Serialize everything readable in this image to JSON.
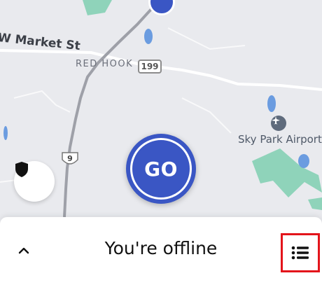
{
  "map": {
    "street_label": "W Market St",
    "town_label": "RED HOOK",
    "route_199": "199",
    "route_9": "9",
    "airport_label": "Sky Park Airport",
    "icons": [
      "navigation-marker-icon",
      "airport-icon"
    ]
  },
  "go_button": {
    "label": "GO"
  },
  "safety": {
    "icon": "shield-icon"
  },
  "bottom_sheet": {
    "title": "You're offline",
    "expand_icon": "chevron-up-icon",
    "menu_icon": "list-icon"
  },
  "colors": {
    "go_blue": "#3a56c4",
    "map_bg": "#e9eaee",
    "park_green": "#8fd3ba",
    "water_blue": "#6b9ce0",
    "highlight_red": "#e3141b"
  }
}
